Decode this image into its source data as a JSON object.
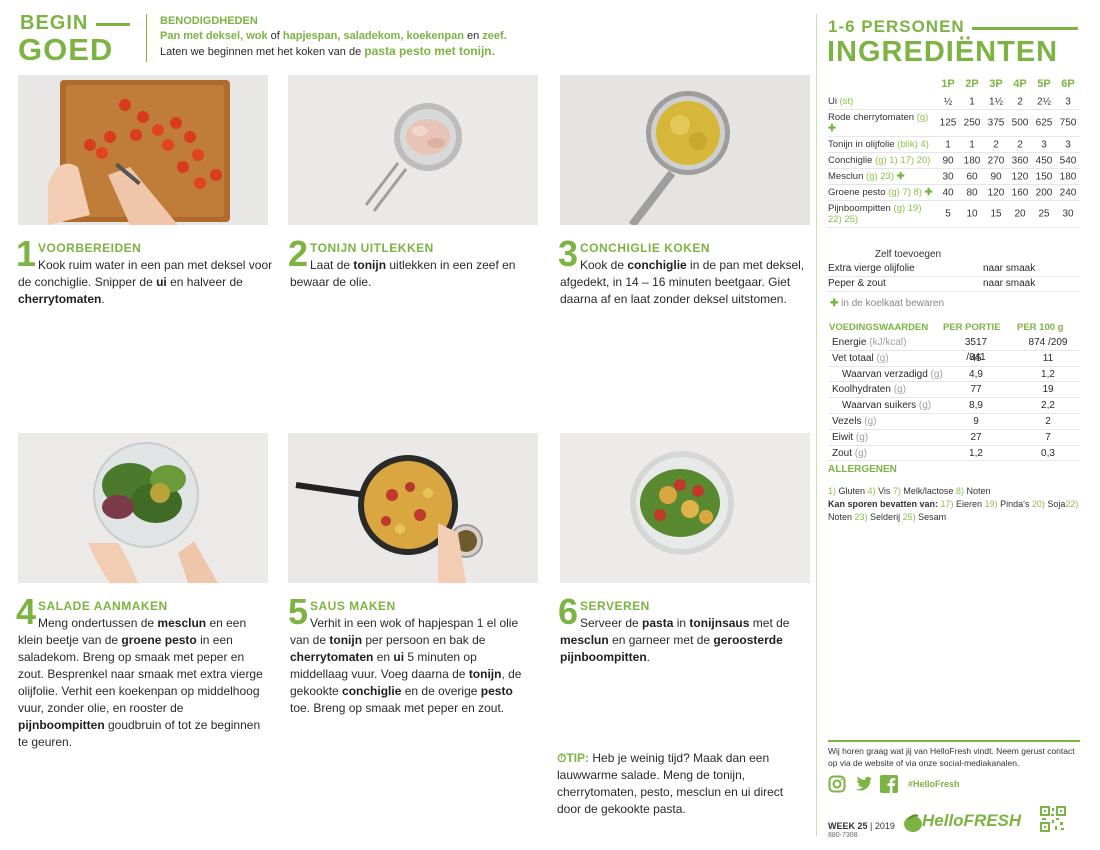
{
  "header": {
    "begin": "BEGIN",
    "goed": "GOED",
    "benodigdheden_title": "BENODIGDHEDEN",
    "equipment": [
      "Pan met deksel",
      "wok",
      "hapjespan",
      "saladekom",
      "koekenpan",
      "zeef"
    ],
    "equipment_seps": [
      ", ",
      " of ",
      ", ",
      ", ",
      " en ",
      "."
    ],
    "intro_prefix": "Laten we beginnen met het koken van de ",
    "dish": "pasta pesto met tonijn."
  },
  "steps": [
    {
      "num": "1",
      "title": "VOORBEREIDEN"
    },
    {
      "num": "2",
      "title": "TONIJN UITLEKKEN"
    },
    {
      "num": "3",
      "title": "CONCHIGLIE KOKEN"
    },
    {
      "num": "4",
      "title": "SALADE AANMAKEN"
    },
    {
      "num": "5",
      "title": "SAUS MAKEN"
    },
    {
      "num": "6",
      "title": "SERVEREN"
    }
  ],
  "step_text": {
    "s1": [
      "Kook ruim water in een pan met deksel voor de conchiglie. Snipper de ",
      "ui",
      " en halveer de ",
      "cherrytomaten",
      "."
    ],
    "s2": [
      "Laat de ",
      "tonijn",
      " uitlekken in een zeef en bewaar de olie."
    ],
    "s3": [
      "Kook de ",
      "conchiglie",
      " in de pan met deksel, afgedekt, in 14 – 16 minuten beetgaar. Giet daarna af en laat zonder deksel uitstomen."
    ],
    "s4": [
      "Meng ondertussen de ",
      "mesclun",
      " en een klein beetje van de ",
      "groene pesto",
      " in een saladekom. Breng op smaak met peper en zout. Besprenkel naar smaak met extra vierge olijfolie.  Verhit een koekenpan op middelhoog vuur, zonder olie, en rooster de ",
      "pijnboompitten",
      " goudbruin of tot ze beginnen te geuren."
    ],
    "s5": [
      "Verhit in een wok of hapjespan 1 el olie van de ",
      "tonijn",
      " per persoon en bak de ",
      "cherrytomaten",
      " en ",
      "ui",
      " 5 minuten op middellaag vuur. Voeg daarna de ",
      "tonijn",
      ", de gekookte ",
      "conchiglie",
      " en de overige ",
      "pesto",
      " toe. Breng op smaak met peper en zout."
    ],
    "s6": [
      "Serveer de ",
      "pasta",
      " in ",
      "tonijnsaus",
      " met de ",
      "mesclun",
      " en garneer met de ",
      "geroosterde pijnboompitten",
      "."
    ]
  },
  "tip": {
    "label": "TIP:",
    "text": " Heb je weinig tijd? Maak dan een lauwwarme salade. Meng de tonijn, cherrytomaten, pesto, mesclun en ui direct door de gekookte pasta."
  },
  "ingredients": {
    "persons": "1-6 PERSONEN",
    "title": "INGREDIËNTEN",
    "columns": [
      "1P",
      "2P",
      "3P",
      "4P",
      "5P",
      "6P"
    ],
    "rows": [
      {
        "name": "Ui",
        "unit": " (st)",
        "allergens": "",
        "fridge": false,
        "values": [
          "½",
          "1",
          "1½",
          "2",
          "2½",
          "3"
        ]
      },
      {
        "name": "Rode cherrytomaten",
        "unit": " (g)",
        "allergens": "",
        "fridge": true,
        "values": [
          "125",
          "250",
          "375",
          "500",
          "625",
          "750"
        ]
      },
      {
        "name": "Tonijn in olijfolie",
        "unit": " (blik)",
        "allergens": " 4)",
        "fridge": false,
        "values": [
          "1",
          "1",
          "2",
          "2",
          "3",
          "3"
        ]
      },
      {
        "name": "Conchiglie",
        "unit": " (g)",
        "allergens": " 1) 17) 20)",
        "fridge": false,
        "values": [
          "90",
          "180",
          "270",
          "360",
          "450",
          "540"
        ]
      },
      {
        "name": "Mesclun",
        "unit": " (g)",
        "allergens": " 23)",
        "fridge": true,
        "values": [
          "30",
          "60",
          "90",
          "120",
          "150",
          "180"
        ]
      },
      {
        "name": "Groene pesto",
        "unit": " (g)",
        "allergens": " 7) 8)",
        "fridge": true,
        "values": [
          "40",
          "80",
          "120",
          "160",
          "200",
          "240"
        ]
      },
      {
        "name": "Pijnboompitten",
        "unit": " (g)",
        "allergens": " 19) 22) 25)",
        "fridge": false,
        "values": [
          "5",
          "10",
          "15",
          "20",
          "25",
          "30"
        ]
      }
    ],
    "zelf_title": "Zelf toevoegen",
    "zelf": [
      {
        "name": "Extra vierge olijfolie",
        "value": "naar smaak"
      },
      {
        "name": "Peper & zout",
        "value": "naar smaak"
      }
    ],
    "fridge_note": " in de koelkaat bewaren"
  },
  "nutrition": {
    "title": "VOEDINGSWAARDEN",
    "col_portion": "PER PORTIE",
    "col_100g": "PER 100 g",
    "rows": [
      {
        "name": "Energie",
        "unit": " (kJ/kcal)",
        "sub": false,
        "portion": "3517 /841",
        "per100": "874 /209"
      },
      {
        "name": "Vet totaal",
        "unit": " (g)",
        "sub": false,
        "portion": "45",
        "per100": "11"
      },
      {
        "name": "Waarvan verzadigd",
        "unit": " (g)",
        "sub": true,
        "portion": "4,9",
        "per100": "1,2"
      },
      {
        "name": "Koolhydraten",
        "unit": " (g)",
        "sub": false,
        "portion": "77",
        "per100": "19"
      },
      {
        "name": "Waarvan suikers",
        "unit": " (g)",
        "sub": true,
        "portion": "8,9",
        "per100": "2,2"
      },
      {
        "name": "Vezels",
        "unit": " (g)",
        "sub": false,
        "portion": "9",
        "per100": "2"
      },
      {
        "name": "Eiwit",
        "unit": " (g)",
        "sub": false,
        "portion": "27",
        "per100": "7"
      },
      {
        "name": "Zout",
        "unit": " (g)",
        "sub": false,
        "portion": "1,2",
        "per100": "0,3"
      }
    ]
  },
  "allergens": {
    "title": "ALLERGENEN",
    "line1": [
      [
        "1)",
        " Gluten "
      ],
      [
        "4)",
        " Vis "
      ],
      [
        "7)",
        " Melk/lactose "
      ],
      [
        "8)",
        " Noten"
      ]
    ],
    "traces_label": "Kan sporen bevatten van: ",
    "traces": [
      [
        "17)",
        " Eieren "
      ],
      [
        "19)",
        " Pinda's "
      ],
      [
        "20)",
        " Soja"
      ],
      [
        "22)",
        " Noten "
      ],
      [
        "23)",
        " Selderij "
      ],
      [
        "25)",
        " Sesam"
      ]
    ]
  },
  "footer": {
    "feedback": "Wij horen graag wat jij van HelloFresh vindt. Neem gerust contact op via de website of via onze social-mediakanalen.",
    "hashtag": "#HelloFresh",
    "week": "WEEK 25",
    "year": " | 2019",
    "code": "880-7308",
    "brand": "HelloFRESH"
  },
  "colors": {
    "accent": "#7cb342",
    "text": "#2a2a2a",
    "rule": "#e6e6e6"
  },
  "icons": [
    "plus-icon",
    "instagram-icon",
    "twitter-icon",
    "facebook-icon",
    "hellofresh-lime-icon",
    "qr-code-icon",
    "timer-icon"
  ]
}
